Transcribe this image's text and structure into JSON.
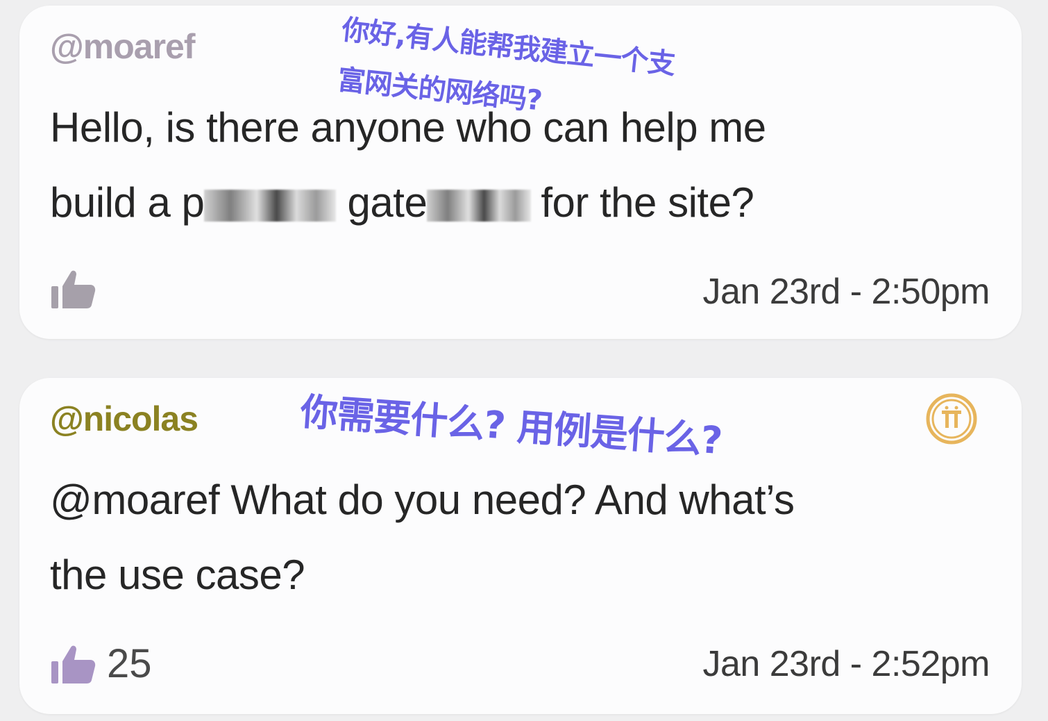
{
  "posts": [
    {
      "username": "@moaref",
      "body_line1": "Hello, is there anyone who can help me",
      "body_line2_start": "build a p",
      "body_line2_mid": " gate",
      "body_line2_end": "for the site?",
      "like_count": "",
      "timestamp": "Jan 23rd - 2:50pm",
      "translation_line1": "你好,有人能帮我建立一个支",
      "translation_line2": "富网关的网络吗?"
    },
    {
      "username": "@nicolas",
      "body_line1": "@moaref What do you need? And what’s",
      "body_line2": "the use case?",
      "like_count": "25",
      "timestamp": "Jan 23rd - 2:52pm",
      "translation": "你需要什么? 用例是什么?",
      "badge_icon": "pi-coin-icon"
    }
  ],
  "colors": {
    "username_1": "#a99fae",
    "username_2": "#8b8222",
    "like_inactive": "#a6a0aa",
    "like_active": "#a894c4",
    "badge": "#e7b55c",
    "translation": "#6a63e6"
  }
}
